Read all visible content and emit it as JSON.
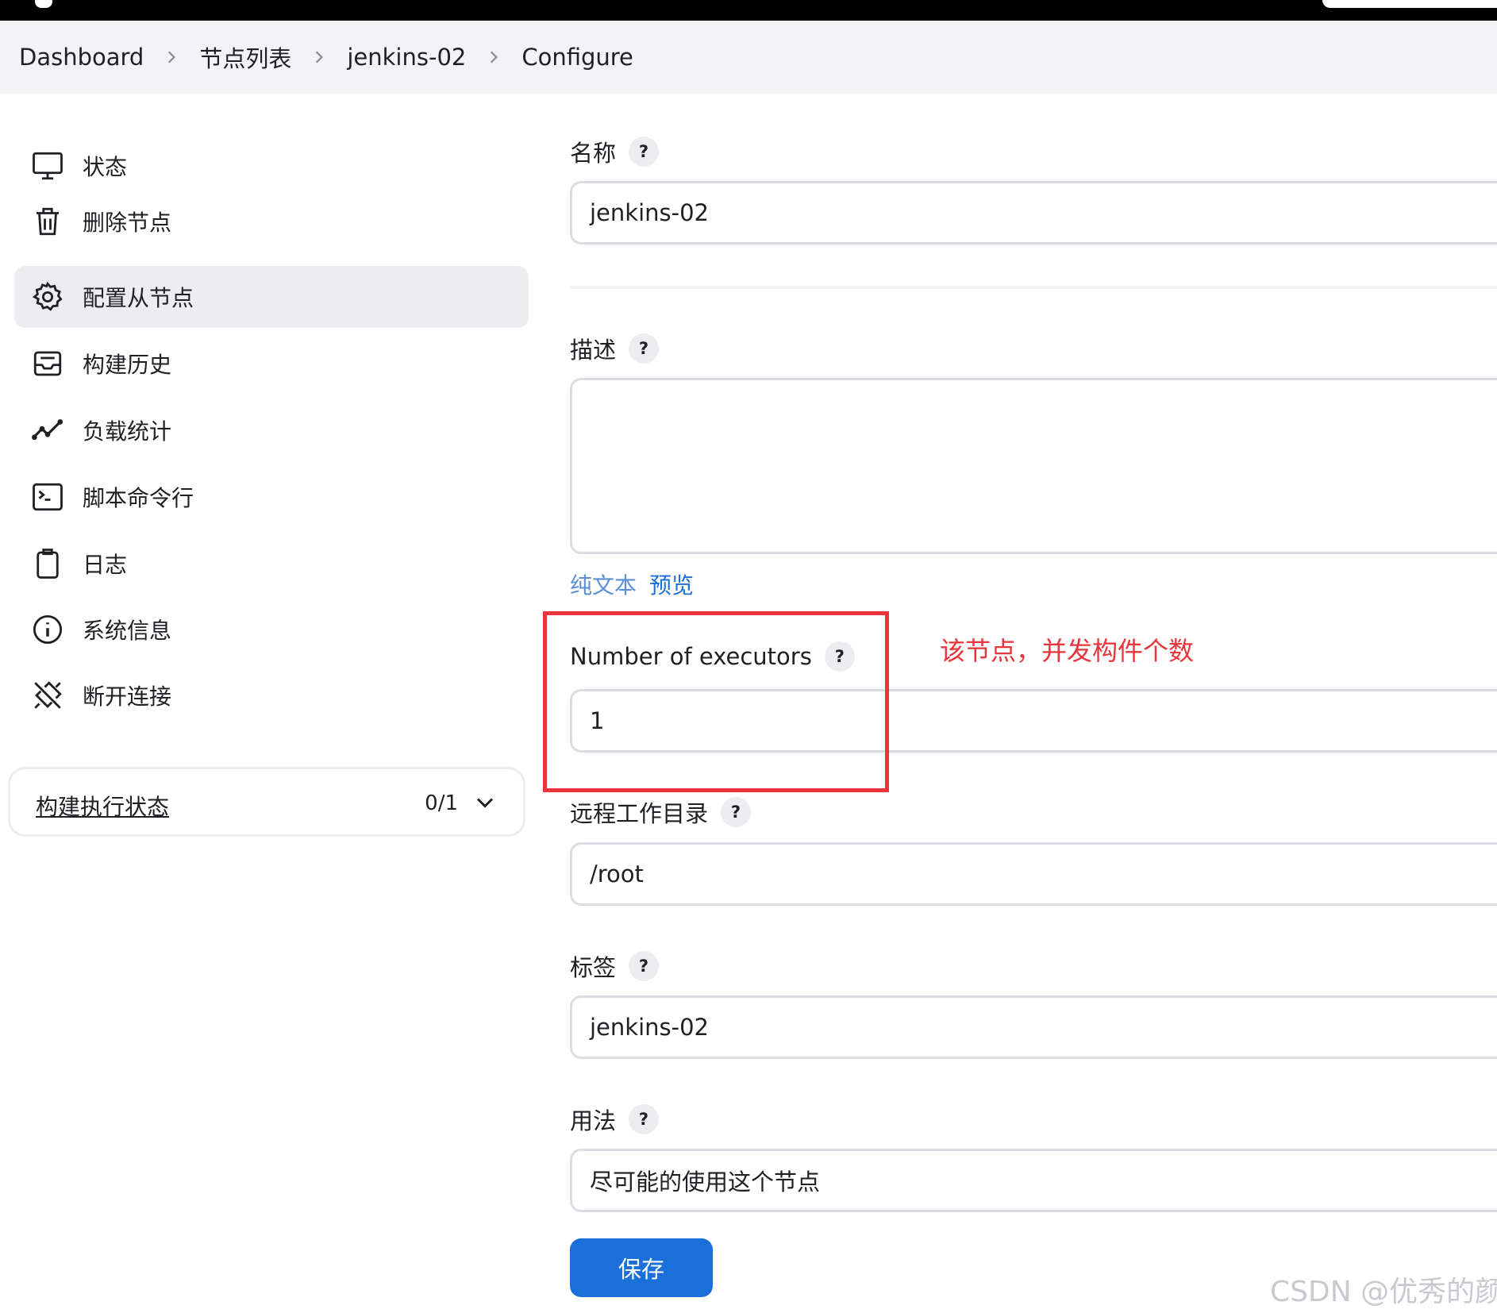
{
  "breadcrumb": [
    "Dashboard",
    "节点列表",
    "jenkins-02",
    "Configure"
  ],
  "sidebar": {
    "items": [
      {
        "label": "状态",
        "icon": "monitor-icon"
      },
      {
        "label": "删除节点",
        "icon": "trash-icon"
      },
      {
        "label": "配置从节点",
        "icon": "gear-icon",
        "active": true
      },
      {
        "label": "构建历史",
        "icon": "inbox-icon"
      },
      {
        "label": "负载统计",
        "icon": "trend-chart-icon"
      },
      {
        "label": "脚本命令行",
        "icon": "terminal-icon"
      },
      {
        "label": "日志",
        "icon": "clipboard-icon"
      },
      {
        "label": "系统信息",
        "icon": "info-icon"
      },
      {
        "label": "断开连接",
        "icon": "disconnect-icon"
      }
    ],
    "executor_panel": {
      "label": "构建执行状态",
      "count": "0/1"
    }
  },
  "form": {
    "name": {
      "label": "名称",
      "value": "jenkins-02"
    },
    "description": {
      "label": "描述",
      "value": ""
    },
    "format": {
      "plain": "纯文本",
      "preview": "预览"
    },
    "executors": {
      "label": "Number of executors",
      "value": "1"
    },
    "remote_dir": {
      "label": "远程工作目录",
      "value": "/root"
    },
    "labels": {
      "label": "标签",
      "value": "jenkins-02"
    },
    "usage": {
      "label": "用法",
      "value": "尽可能的使用这个节点"
    },
    "help_symbol": "?",
    "save_label": "保存"
  },
  "annotation": "该节点，并发构件个数",
  "watermark": "CSDN @优秀的颜",
  "colors": {
    "accent": "#1a6fd8",
    "annotation": "#e8353b",
    "active_bg": "#ececf1"
  }
}
